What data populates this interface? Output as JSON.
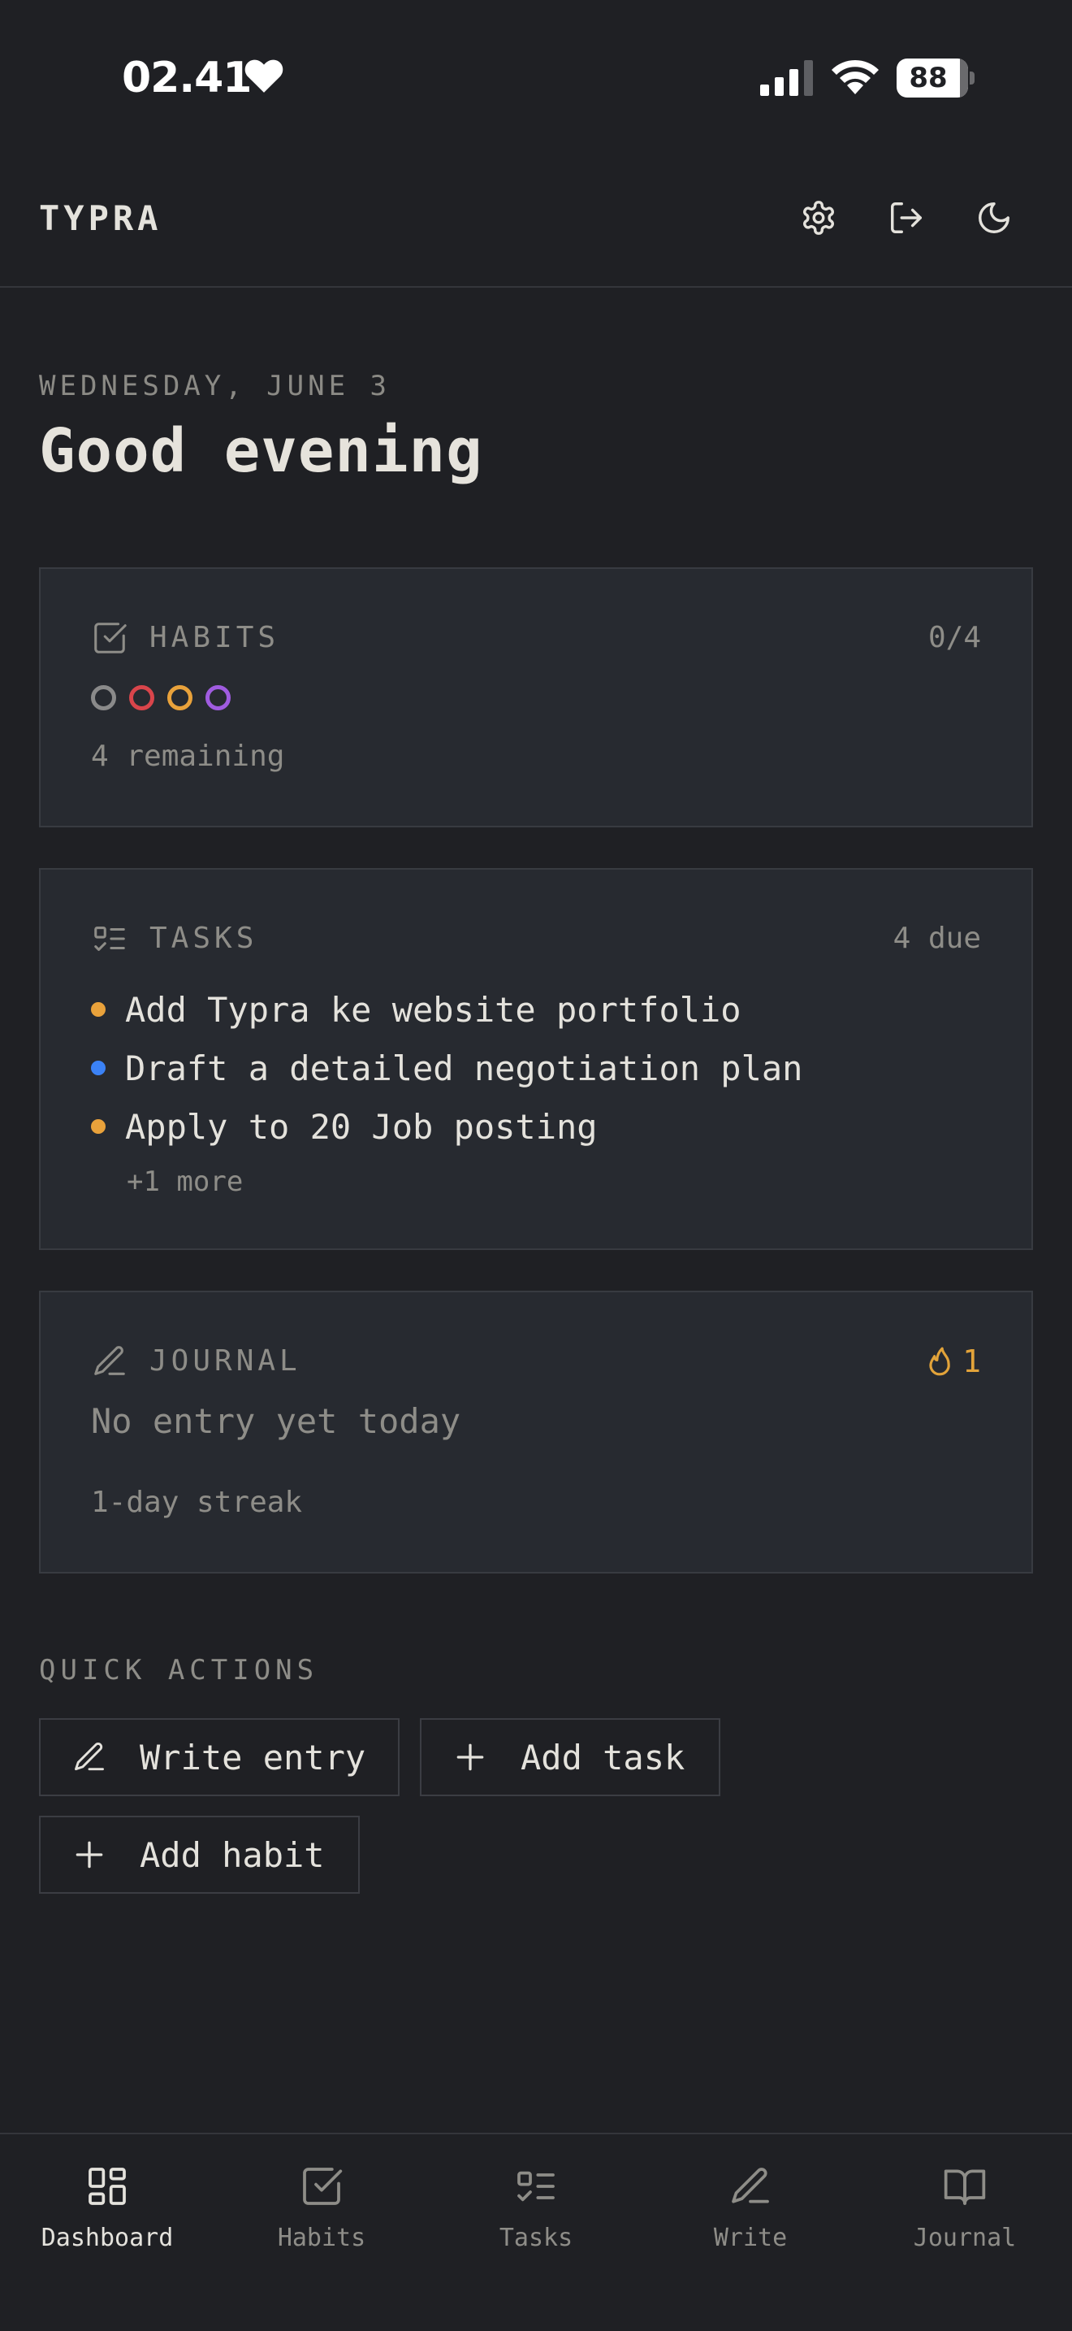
{
  "status_bar": {
    "time": "02.41",
    "heart_icon": "heart-icon",
    "battery": "88"
  },
  "header": {
    "logo": "TYPRA",
    "actions": [
      {
        "name": "settings-button",
        "icon": "gear-icon"
      },
      {
        "name": "logout-button",
        "icon": "logout-icon"
      },
      {
        "name": "theme-toggle-button",
        "icon": "moon-icon"
      }
    ]
  },
  "greeting": {
    "date": "WEDNESDAY, JUNE 3",
    "message": "Good evening"
  },
  "habits": {
    "title": "HABITS",
    "progress": "0/4",
    "dots": [
      "#8a8a8a",
      "#d9454b",
      "#e9a23b",
      "#a05ce0"
    ],
    "remaining": "4 remaining"
  },
  "tasks": {
    "title": "TASKS",
    "due": "4 due",
    "items": [
      {
        "text": "Add Typra ke website portfolio",
        "color": "#e9a23b"
      },
      {
        "text": "Draft a detailed negotiation plan",
        "color": "#3b82f6"
      },
      {
        "text": "Apply to 20 Job posting",
        "color": "#e9a23b"
      }
    ],
    "more": "+1 more"
  },
  "journal": {
    "title": "JOURNAL",
    "streak_count": "1",
    "status": "No entry yet today",
    "streak_text": "1-day streak",
    "accent": "#e2a33a"
  },
  "quick_actions": {
    "label": "QUICK ACTIONS",
    "write_entry": "Write entry",
    "add_task": "Add task",
    "add_habit": "Add habit"
  },
  "nav": {
    "dashboard": "Dashboard",
    "habits": "Habits",
    "tasks": "Tasks",
    "write": "Write",
    "journal": "Journal",
    "active": "Dashboard"
  }
}
